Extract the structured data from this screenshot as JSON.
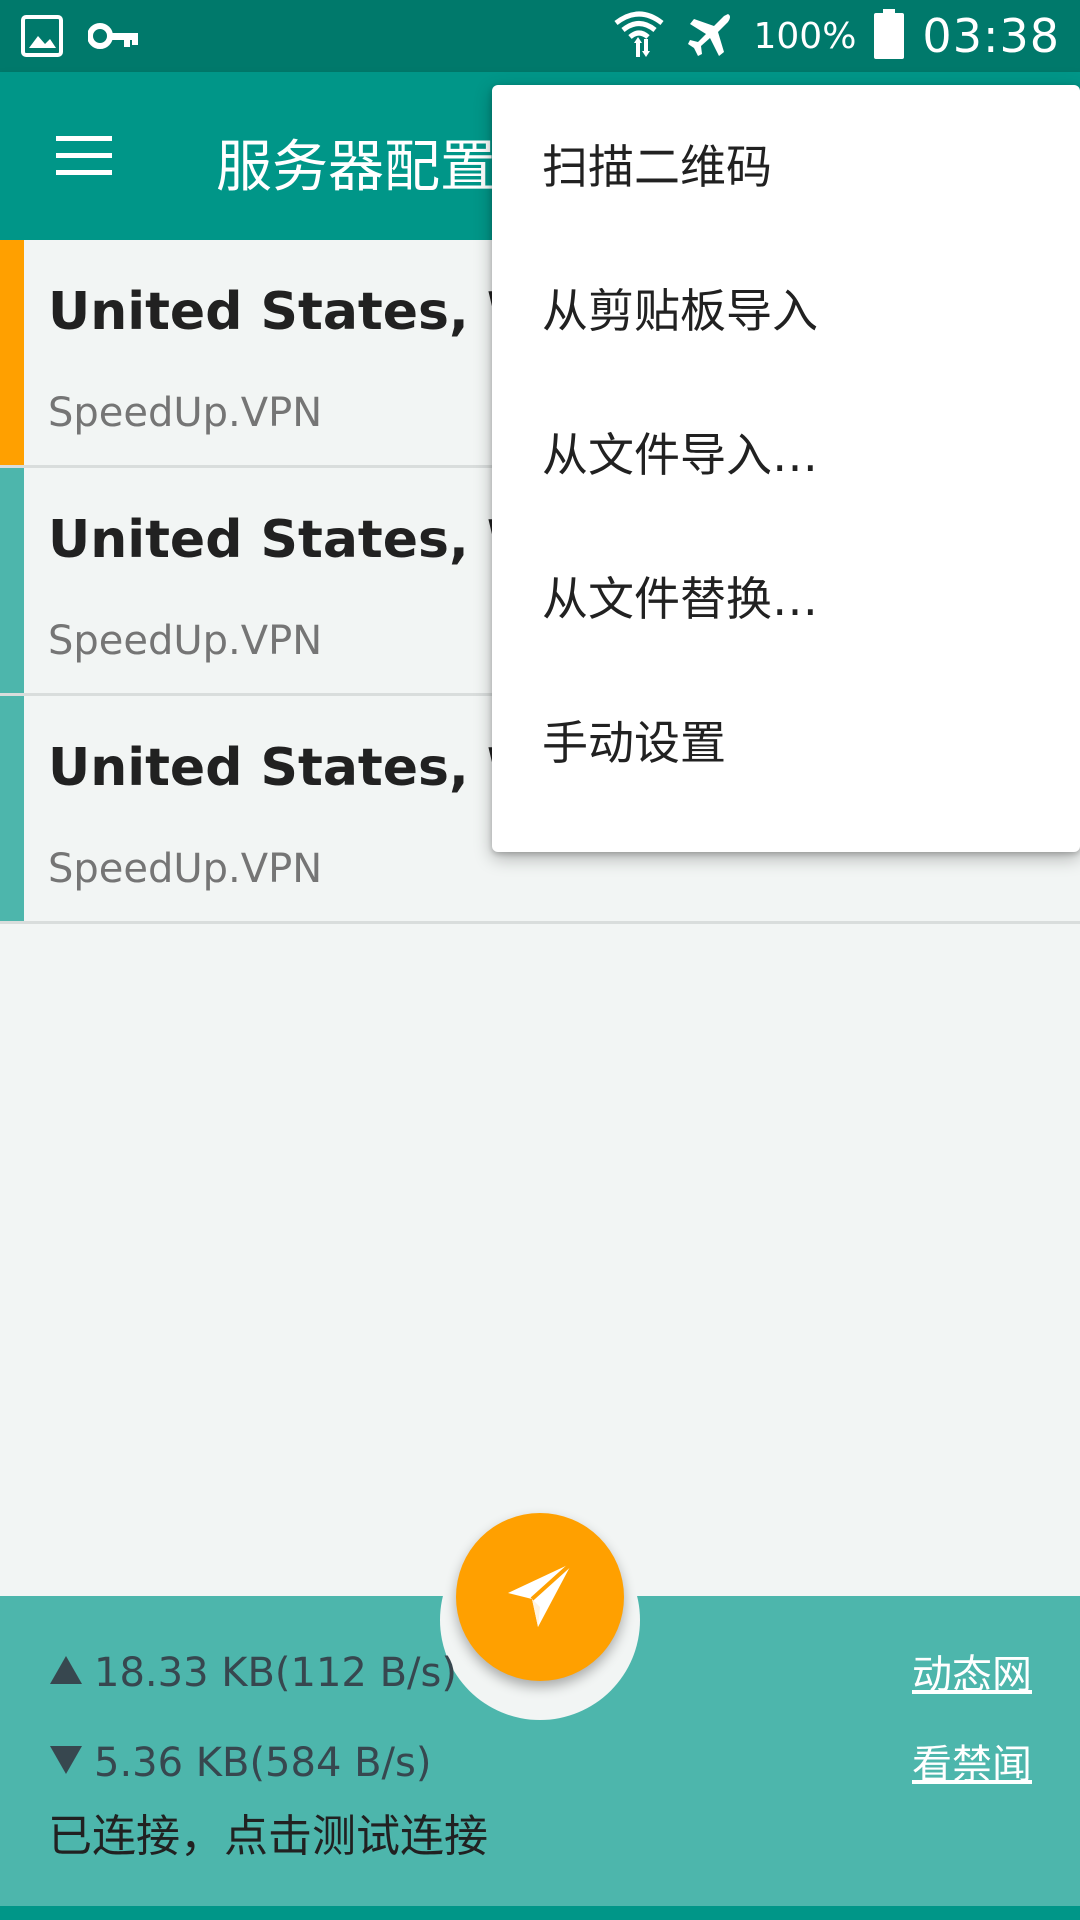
{
  "status_bar": {
    "left_icons": [
      "image-icon",
      "key-icon"
    ],
    "right_icons": [
      "wifi-icon",
      "airplane-icon",
      "battery-icon"
    ],
    "battery_percent": "100%",
    "time": "03:38"
  },
  "app_bar": {
    "title": "服务器配置",
    "menu_icon": "hamburger-menu-icon"
  },
  "servers": [
    {
      "name": "United States, Was",
      "subtitle": "SpeedUp.VPN",
      "selected": true
    },
    {
      "name": "United States, Was",
      "subtitle": "SpeedUp.VPN",
      "selected": false
    },
    {
      "name": "United States, Was",
      "subtitle": "SpeedUp.VPN",
      "selected": false
    }
  ],
  "popup_menu": {
    "items": [
      "扫描二维码",
      "从剪贴板导入",
      "从文件导入…",
      "从文件替换…",
      "手动设置"
    ]
  },
  "bottom_bar": {
    "upload": "18.33 KB(112 B/s)",
    "download": "5.36 KB(584 B/s)",
    "status": "已连接，点击测试连接",
    "link_1": "动态网",
    "link_2": "看禁闻",
    "fab_icon": "paper-plane-icon"
  },
  "colors": {
    "primary_dark": "#00796b",
    "primary": "#009688",
    "accent": "#ffa000",
    "bottom_bar": "#4db6ac"
  }
}
